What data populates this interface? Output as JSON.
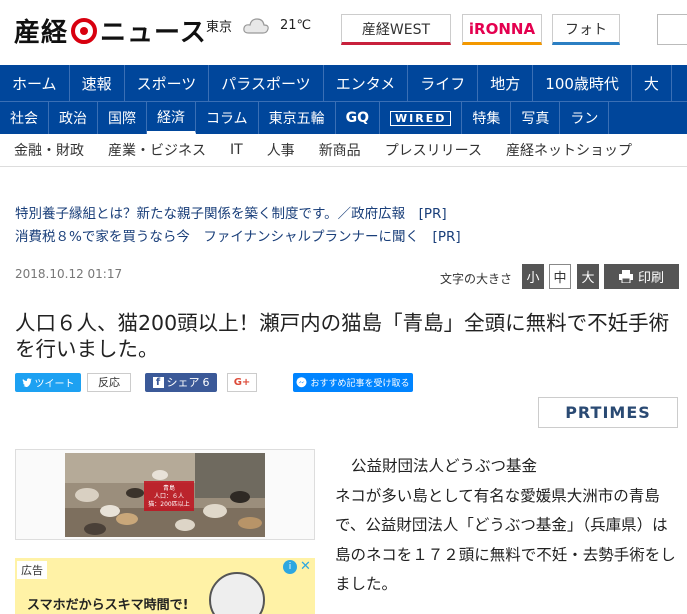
{
  "header": {
    "logo_text_left": "産経",
    "logo_text_right": "ニュース",
    "weather_city": "東京",
    "weather_temp": "21℃",
    "west_label": "産経WEST",
    "ironna_label": "iRONNA",
    "photo_label": "フォト"
  },
  "nav_primary": [
    "ホーム",
    "速報",
    "スポーツ",
    "パラスポーツ",
    "エンタメ",
    "ライフ",
    "地方",
    "100歳時代",
    "大"
  ],
  "nav_secondary": [
    "社会",
    "政治",
    "国際",
    "経済",
    "コラム",
    "東京五輪",
    "GQ",
    "WIRED",
    "特集",
    "写真",
    "ラン"
  ],
  "nav_secondary_active": "経済",
  "nav_tertiary": [
    "金融・財政",
    "産業・ビジネス",
    "IT",
    "人事",
    "新商品",
    "プレスリリース",
    "産経ネットショップ"
  ],
  "pr_links": [
    "特別養子縁組とは？新たな親子関係を築く制度です。／政府広報　[PR]",
    "消費税８%で家を買うなら今　ファイナンシャルプランナーに聞く　[PR]"
  ],
  "article": {
    "date": "2018.10.12 01:17",
    "fontsize_label": "文字の大きさ",
    "fs_small": "小",
    "fs_mid": "中",
    "fs_large": "大",
    "print_label": "印刷",
    "headline": "人口６人、猫200頭以上！瀬戸内の猫島「青島」全頭に無料で不妊手術を行いました。",
    "body_org": "公益財団法人どうぶつ基金",
    "body_paragraph": "ネコが多い島として有名な愛媛県大洲市の青島で、公益財団法人「どうぶつ基金」（兵庫県）は島のネコを１７２頭に無料で不妊・去勢手術をしました。"
  },
  "share": {
    "tweet_label": "ツイート",
    "tweet_count": "反応",
    "fb_label": "シェア",
    "fb_count": "6",
    "gplus_label": "G+",
    "messenger_label": "おすすめ記事を受け取る"
  },
  "prtimes_label": "PRTIMES",
  "photo_caption_lines": [
    "青島",
    "人口：６人",
    "猫：200匹以上"
  ],
  "ad": {
    "label": "広告",
    "text": "スマホだからスキマ時間で!"
  }
}
